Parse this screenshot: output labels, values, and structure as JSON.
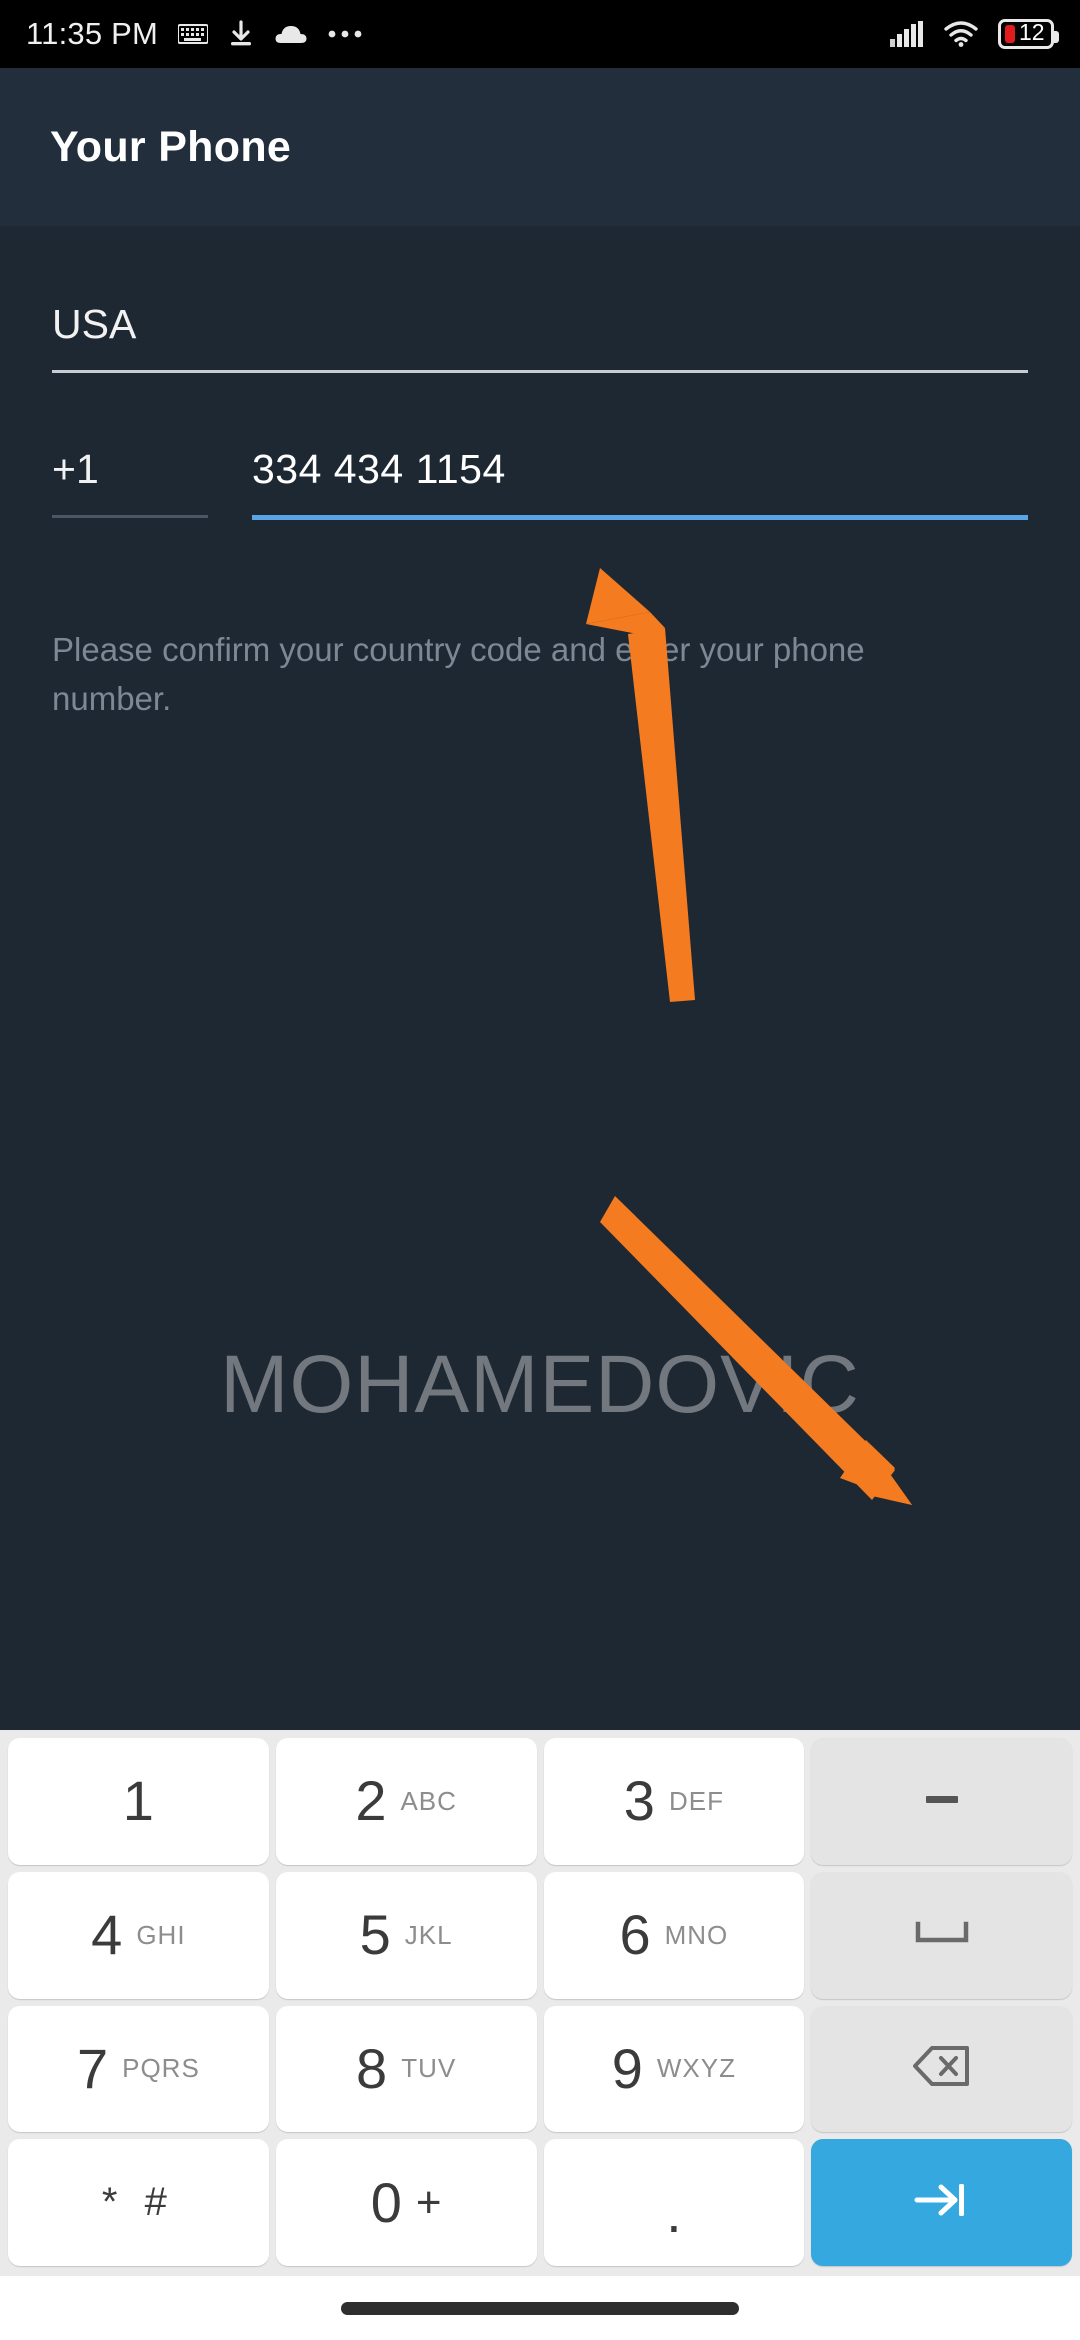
{
  "status_bar": {
    "time": "11:35 PM",
    "left_icons": [
      "keyboard-icon",
      "download-icon",
      "cloud-icon",
      "more-dots-icon"
    ],
    "right_icons": [
      "signal-icon",
      "wifi-icon",
      "battery-icon"
    ],
    "battery_percent": "12",
    "battery_color": "#E01B1B",
    "background": "#000000"
  },
  "app_bar": {
    "title": "Your Phone",
    "background": "#222E3C"
  },
  "form": {
    "country": {
      "label": "country-field",
      "value": "USA",
      "underline_color": "#c9cdd2"
    },
    "country_code": {
      "value": "+1",
      "underline_color": "#4b5663"
    },
    "phone_number": {
      "value": "334 434 1154",
      "underline_color": "#5AA4E6",
      "focused": true
    },
    "hint": "Please confirm your country code and enter your phone number."
  },
  "watermark": {
    "text": "MOHAMEDOVIC",
    "color": "#7a7f85"
  },
  "fab": {
    "icon": "arrow-right-icon",
    "color": "#5BA4E0"
  },
  "annotations": {
    "accent_color": "#F47B20",
    "arrows": [
      {
        "name": "arrow-to-phone-field",
        "direction": "up-left"
      },
      {
        "name": "arrow-to-fab",
        "direction": "down-right"
      }
    ]
  },
  "keyboard": {
    "background": "#EAEAEA",
    "rows": [
      [
        {
          "name": "key-1",
          "digit": "1",
          "letters": "",
          "type": "digit"
        },
        {
          "name": "key-2",
          "digit": "2",
          "letters": "ABC",
          "type": "digit"
        },
        {
          "name": "key-3",
          "digit": "3",
          "letters": "DEF",
          "type": "digit"
        },
        {
          "name": "key-dash",
          "glyph": "–",
          "type": "function"
        }
      ],
      [
        {
          "name": "key-4",
          "digit": "4",
          "letters": "GHI",
          "type": "digit"
        },
        {
          "name": "key-5",
          "digit": "5",
          "letters": "JKL",
          "type": "digit"
        },
        {
          "name": "key-6",
          "digit": "6",
          "letters": "MNO",
          "type": "digit"
        },
        {
          "name": "key-space",
          "glyph": "space-icon",
          "type": "function"
        }
      ],
      [
        {
          "name": "key-7",
          "digit": "7",
          "letters": "PQRS",
          "type": "digit"
        },
        {
          "name": "key-8",
          "digit": "8",
          "letters": "TUV",
          "type": "digit"
        },
        {
          "name": "key-9",
          "digit": "9",
          "letters": "WXYZ",
          "type": "digit"
        },
        {
          "name": "key-backspace",
          "glyph": "backspace-icon",
          "type": "function"
        }
      ],
      [
        {
          "name": "key-star-hash",
          "digit": "* #",
          "letters": "",
          "type": "symbol"
        },
        {
          "name": "key-0",
          "digit": "0",
          "letters": "+",
          "type": "digit"
        },
        {
          "name": "key-period",
          "digit": ".",
          "letters": "",
          "type": "symbol"
        },
        {
          "name": "key-enter",
          "glyph": "tab-enter-icon",
          "type": "accent",
          "color": "#35A8E0"
        }
      ]
    ],
    "labels": {
      "k1": "1",
      "k2": "2",
      "k2s": "ABC",
      "k3": "3",
      "k3s": "DEF",
      "k4": "4",
      "k4s": "GHI",
      "k5": "5",
      "k5s": "JKL",
      "k6": "6",
      "k6s": "MNO",
      "k7": "7",
      "k7s": "PQRS",
      "k8": "8",
      "k8s": "TUV",
      "k9": "9",
      "k9s": "WXYZ",
      "kstar": "* #",
      "k0": "0",
      "k0s": "+",
      "kdot": ".",
      "kdash": "–"
    }
  },
  "nav_bar": {
    "gesture_pill": "home-gesture-pill",
    "background": "#FFFFFF"
  }
}
